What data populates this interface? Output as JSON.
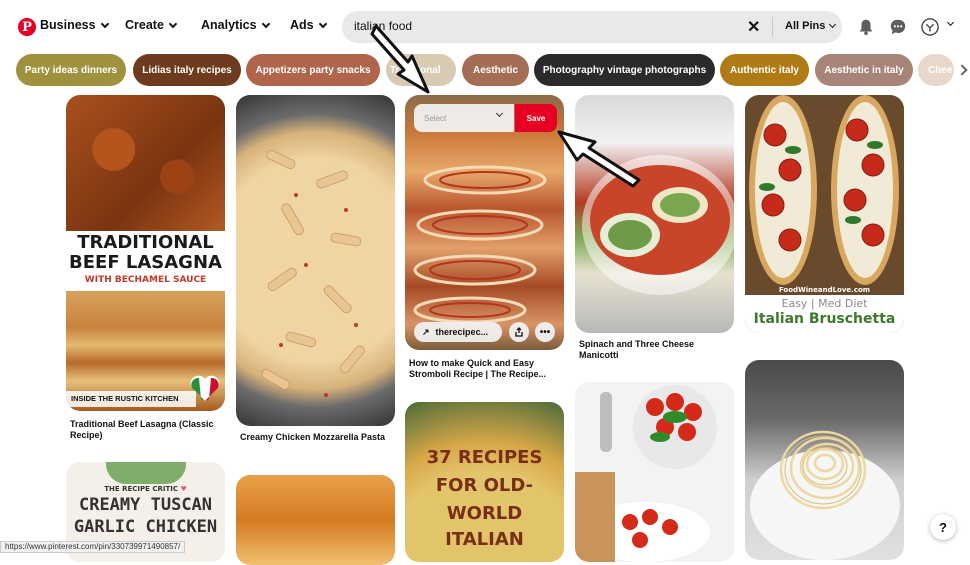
{
  "header": {
    "logo_letter": "P",
    "business_label": "Business",
    "create_label": "Create",
    "analytics_label": "Analytics",
    "ads_label": "Ads",
    "search_value": "italian food",
    "search_scope": "All Pins"
  },
  "chips": [
    {
      "label": "Party ideas dinners",
      "color": "#a0913e"
    },
    {
      "label": "Lidias italy recipes",
      "color": "#6e3b1c"
    },
    {
      "label": "Appetizers party snacks",
      "color": "#b0654a"
    },
    {
      "label": "Traditional",
      "color": "#d9cbb3"
    },
    {
      "label": "Aesthetic",
      "color": "#a46e55"
    },
    {
      "label": "Photography vintage photographs",
      "color": "#2a2a2a"
    },
    {
      "label": "Authentic italy",
      "color": "#b07a14"
    },
    {
      "label": "Aesthetic in italy",
      "color": "#a88478"
    },
    {
      "label": "Chee",
      "color": "#e8d8cc"
    }
  ],
  "pins": {
    "lasagna": {
      "line1": "TRADITIONAL",
      "line2": "BEEF LASAGNA",
      "line3": "WITH BECHAMEL SAUCE",
      "footer": "INSIDE THE RUSTIC KITCHEN",
      "title": "Traditional Beef Lasagna (Classic Recipe)"
    },
    "pasta": {
      "title": "Creamy Chicken Mozzarella Pasta"
    },
    "stromboli": {
      "title": "How to make Quick and Easy Stromboli Recipe | The Recipe...",
      "select_label": "Select",
      "save_label": "Save",
      "link_label": "therecipec...",
      "share_icon": "share-icon",
      "more_icon": "more-icon"
    },
    "manicotti": {
      "title": "Spinach and Three Cheese Manicotti"
    },
    "bruschetta": {
      "site": "FoodWineandLove.com",
      "sub": "Easy | Med Diet",
      "name": "Italian Bruschetta"
    },
    "tuscan": {
      "brand": "THE RECIPE CRITIC",
      "line1": "CREAMY TUSCAN",
      "line2": "GARLIC CHICKEN"
    },
    "recipes37": {
      "line1": "37 RECIPES",
      "line2": "FOR OLD-",
      "line3": "WORLD",
      "line4": "ITALIAN"
    }
  },
  "status_url": "https://www.pinterest.com/pin/330739971490857/",
  "help_label": "?"
}
